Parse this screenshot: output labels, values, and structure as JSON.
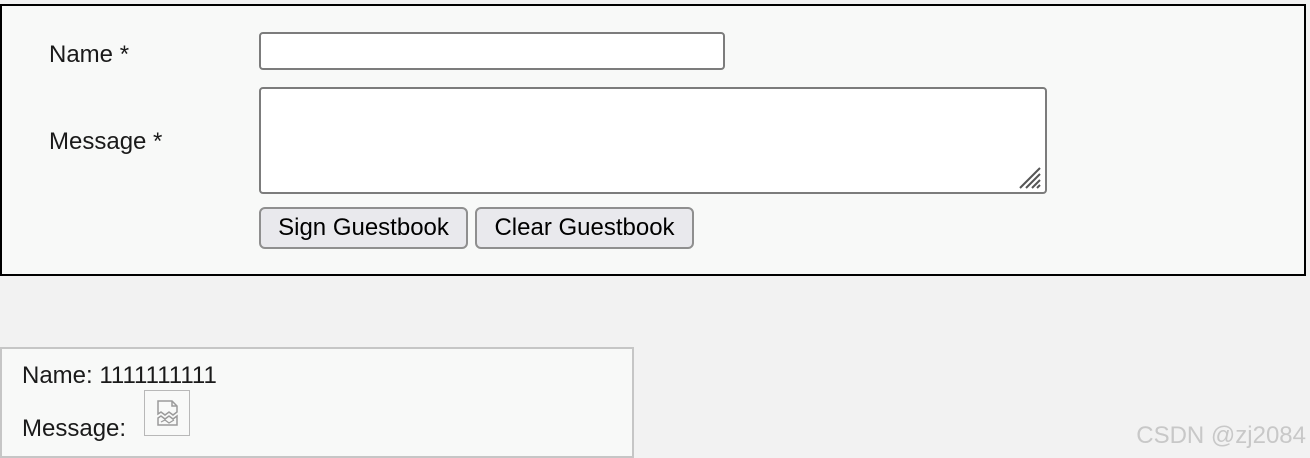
{
  "form": {
    "name_label": "Name *",
    "message_label": "Message *",
    "name_value": "",
    "message_value": "",
    "sign_button": "Sign Guestbook",
    "clear_button": "Clear Guestbook"
  },
  "entry": {
    "name_line": "Name: 1111111111",
    "message_label": "Message:",
    "message_image": "broken-image-icon"
  },
  "watermark": "CSDN @zj2084",
  "colors": {
    "form_border": "#000000",
    "page_background": "#f2f2f2",
    "panel_background": "#f8f9f8",
    "button_background": "#e9e9ed",
    "entry_border": "#c6c6c6"
  }
}
